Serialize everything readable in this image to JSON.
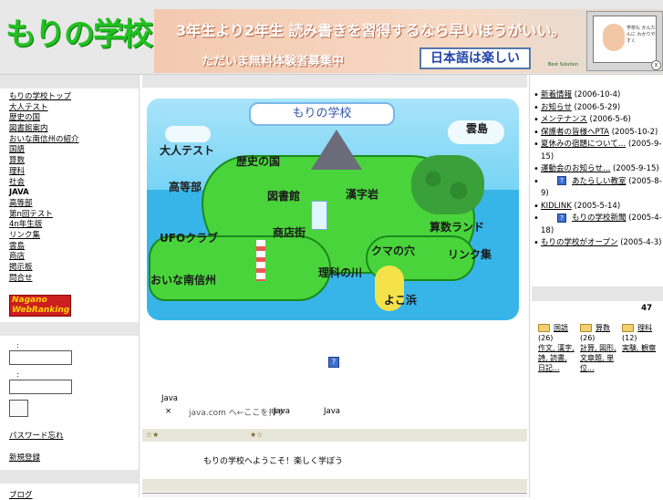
{
  "header": {
    "logo": "もりの学校",
    "banner_line1": "3年生より2年生 読み書きを習得するなら早いほうがいい。",
    "banner_line2": "ただいま無料体験者募集中",
    "banner_button": "日本語は楽しい",
    "banner_laptop_text": "学校も かんたんに わかりやすく",
    "banner_tiny": "Best Solution",
    "banner_close": "x"
  },
  "left_menu": {
    "items": [
      {
        "label": "もりの学校トップ"
      },
      {
        "label": "大人テスト"
      },
      {
        "label": "歴史の国"
      },
      {
        "label": "図書館案内"
      },
      {
        "label": "おいな南信州の紹介"
      },
      {
        "label": "国語"
      },
      {
        "label": "算数"
      },
      {
        "label": "理科"
      },
      {
        "label": "社会"
      },
      {
        "label": "JAVA",
        "bold": true
      },
      {
        "label": "高等部"
      },
      {
        "label": "第n回テスト"
      },
      {
        "label": "4n年生版"
      },
      {
        "label": "リンク集"
      },
      {
        "label": "雲島"
      },
      {
        "label": "商店"
      },
      {
        "label": "掲示板"
      },
      {
        "label": "問合せ"
      }
    ],
    "nagano_line1": "Nagano",
    "nagano_line2": "WebRanking",
    "field1_label": ":",
    "field2_label": ":",
    "link1": "パスワード忘れ",
    "link2": "新規登録",
    "link3": "ブログ"
  },
  "map": {
    "title": "もりの学校",
    "labels": [
      "大人テスト",
      "歴史の国",
      "雲島",
      "高等部",
      "図書館",
      "漢字岩",
      "UFOクラブ",
      "商店街",
      "算数ランド",
      "クマの穴",
      "リンク集",
      "理科の川",
      "おいな南信州",
      "よこ浜"
    ]
  },
  "center": {
    "java_label": "Java",
    "java_mark": "×",
    "javacom_link": "java.com へ←ここを押す",
    "java_word2": "Java",
    "java_word3": "Java",
    "bar_star_left": "☆★",
    "bar_star_right": "★☆",
    "message": "もりの学校へようこそ！楽しく学ぼう"
  },
  "right_panel": {
    "news": [
      {
        "label": "新着情報",
        "date": "(2006-10-4)"
      },
      {
        "label": "お知らせ",
        "date": "(2006-5-29)"
      },
      {
        "label": "メンテナンス",
        "date": "(2006-5-6)"
      },
      {
        "label": "保護者の皆様へPTA",
        "date": "(2005-10-2)"
      },
      {
        "label": "夏休みの宿題について…",
        "date": "(2005-9-15)"
      },
      {
        "label": "運動会のお知らせ…",
        "date": "(2005-9-15)"
      },
      {
        "label": "あたらしい教室",
        "date": "(2005-8-9)",
        "icon": true
      },
      {
        "label": "KIDLINK",
        "date": "(2005-5-14)"
      },
      {
        "label": "もりの学校新聞",
        "date": "(2005-4-18)",
        "icon": true
      },
      {
        "label": "もりの学校がオープン",
        "date": "(2005-4-3)"
      }
    ],
    "count": "47",
    "folders": [
      {
        "name": "国語",
        "count": "(26)",
        "items": "作文, 漢字, 詩, 読書, 日記..."
      },
      {
        "name": "算数",
        "count": "(26)",
        "items": "計算, 図形, 文章題, 単位..."
      },
      {
        "name": "理科",
        "count": "(12)",
        "items": "実験, 観察"
      }
    ]
  }
}
